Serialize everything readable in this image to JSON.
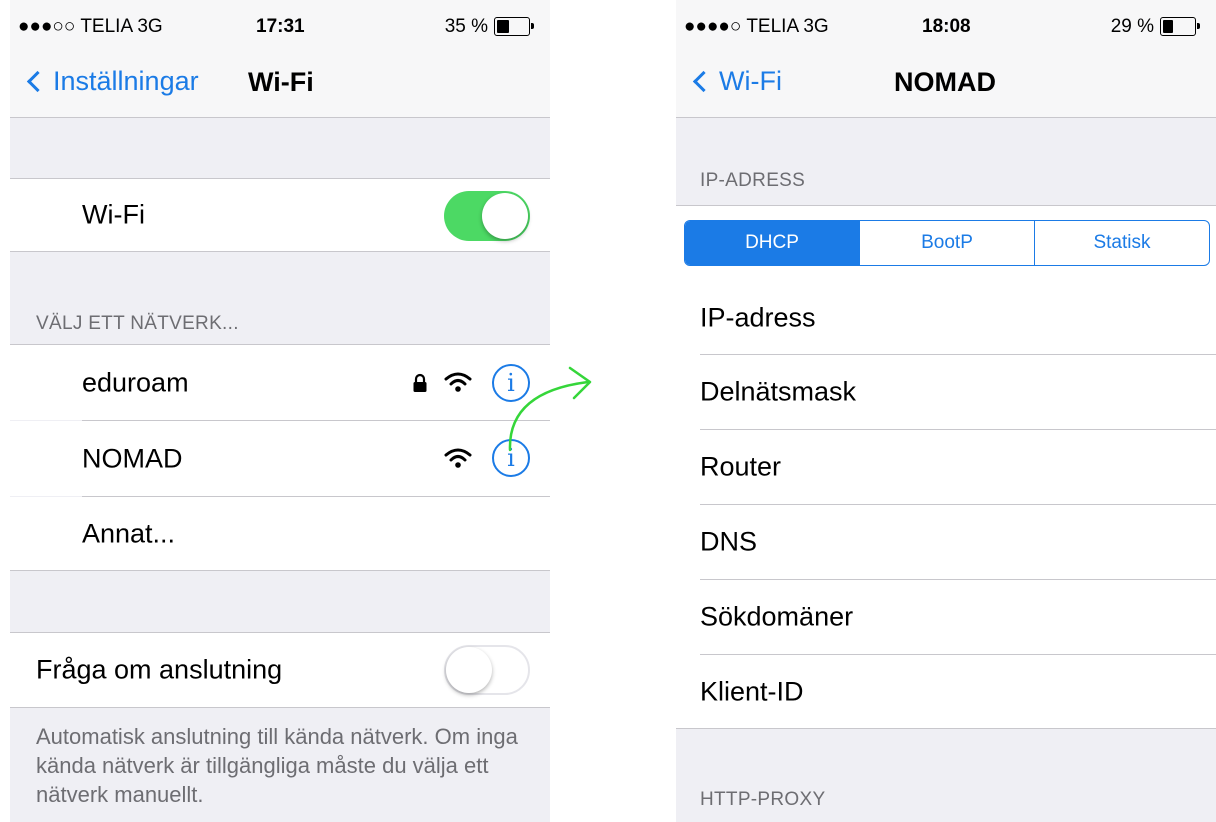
{
  "left": {
    "statusbar": {
      "carrier": "●●●○○ TELIA  3G",
      "time": "17:31",
      "battery_pct": "35 %",
      "battery_level": 0.35
    },
    "nav": {
      "back_label": "Inställningar",
      "title": "Wi-Fi"
    },
    "wifi_row": {
      "label": "Wi-Fi",
      "toggle_on": true
    },
    "networks_header": "VÄLJ ETT NÄTVERK...",
    "networks": [
      {
        "name": "eduroam",
        "secured": true,
        "info_label": "i"
      },
      {
        "name": "NOMAD",
        "secured": false,
        "info_label": "i"
      }
    ],
    "other_network": "Annat...",
    "ask_row": {
      "label": "Fråga om anslutning",
      "toggle_on": false
    },
    "footer": "Automatisk anslutning till kända nätverk. Om inga kända nätverk är tillgängliga måste du välja ett nätverk manuellt."
  },
  "right": {
    "statusbar": {
      "carrier": "●●●●○ TELIA  3G",
      "time": "18:08",
      "battery_pct": "29 %",
      "battery_level": 0.29
    },
    "nav": {
      "back_label": "Wi-Fi",
      "title": "NOMAD"
    },
    "ip_header": "IP-ADRESS",
    "segments": [
      {
        "label": "DHCP",
        "active": true
      },
      {
        "label": "BootP",
        "active": false
      },
      {
        "label": "Statisk",
        "active": false
      }
    ],
    "fields": [
      "IP-adress",
      "Delnätsmask",
      "Router",
      "DNS",
      "Sökdomäner",
      "Klient-ID"
    ],
    "proxy_header": "HTTP-PROXY"
  },
  "colors": {
    "accent": "#1b7be6",
    "toggle_on": "#4cd964",
    "arrow": "#35d63a",
    "group_bg": "#efeff4"
  },
  "icons": [
    "chevron-left-icon",
    "lock-icon",
    "wifi-icon",
    "info-icon",
    "battery-icon",
    "arrow-icon"
  ]
}
